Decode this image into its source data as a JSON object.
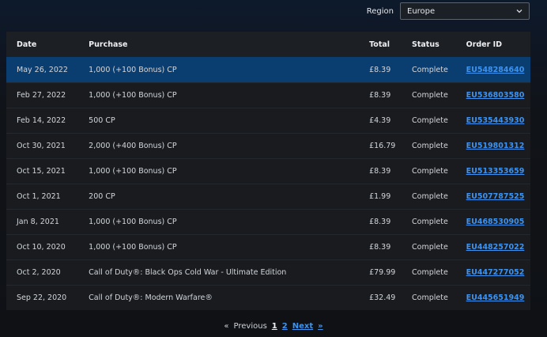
{
  "region": {
    "label": "Region",
    "selected": "Europe"
  },
  "table": {
    "headers": {
      "date": "Date",
      "purchase": "Purchase",
      "total": "Total",
      "status": "Status",
      "order_id": "Order ID"
    },
    "rows": [
      {
        "date": "May 26, 2022",
        "purchase": "1,000 (+100 Bonus) CP",
        "total": "£8.39",
        "status": "Complete",
        "order_id": "EU548284640"
      },
      {
        "date": "Feb 27, 2022",
        "purchase": "1,000 (+100 Bonus) CP",
        "total": "£8.39",
        "status": "Complete",
        "order_id": "EU536803580"
      },
      {
        "date": "Feb 14, 2022",
        "purchase": "500 CP",
        "total": "£4.39",
        "status": "Complete",
        "order_id": "EU535443930"
      },
      {
        "date": "Oct 30, 2021",
        "purchase": "2,000 (+400 Bonus) CP",
        "total": "£16.79",
        "status": "Complete",
        "order_id": "EU519801312"
      },
      {
        "date": "Oct 15, 2021",
        "purchase": "1,000 (+100 Bonus) CP",
        "total": "£8.39",
        "status": "Complete",
        "order_id": "EU513353659"
      },
      {
        "date": "Oct 1, 2021",
        "purchase": "200 CP",
        "total": "£1.99",
        "status": "Complete",
        "order_id": "EU507787525"
      },
      {
        "date": "Jan 8, 2021",
        "purchase": "1,000 (+100 Bonus) CP",
        "total": "£8.39",
        "status": "Complete",
        "order_id": "EU468530905"
      },
      {
        "date": "Oct 10, 2020",
        "purchase": "1,000 (+100 Bonus) CP",
        "total": "£8.39",
        "status": "Complete",
        "order_id": "EU448257022"
      },
      {
        "date": "Oct 2, 2020",
        "purchase": "Call of Duty®: Black Ops Cold War - Ultimate Edition",
        "total": "£79.99",
        "status": "Complete",
        "order_id": "EU447277052"
      },
      {
        "date": "Sep 22, 2020",
        "purchase": "Call of Duty®: Modern Warfare®",
        "total": "£32.49",
        "status": "Complete",
        "order_id": "EU445651949"
      }
    ]
  },
  "pagination": {
    "first": "«",
    "previous": "Previous",
    "pages": [
      "1",
      "2"
    ],
    "current": "1",
    "next": "Next",
    "last": "»"
  },
  "colors": {
    "selected_row": "#0b3e70",
    "link": "#3d93f0"
  }
}
